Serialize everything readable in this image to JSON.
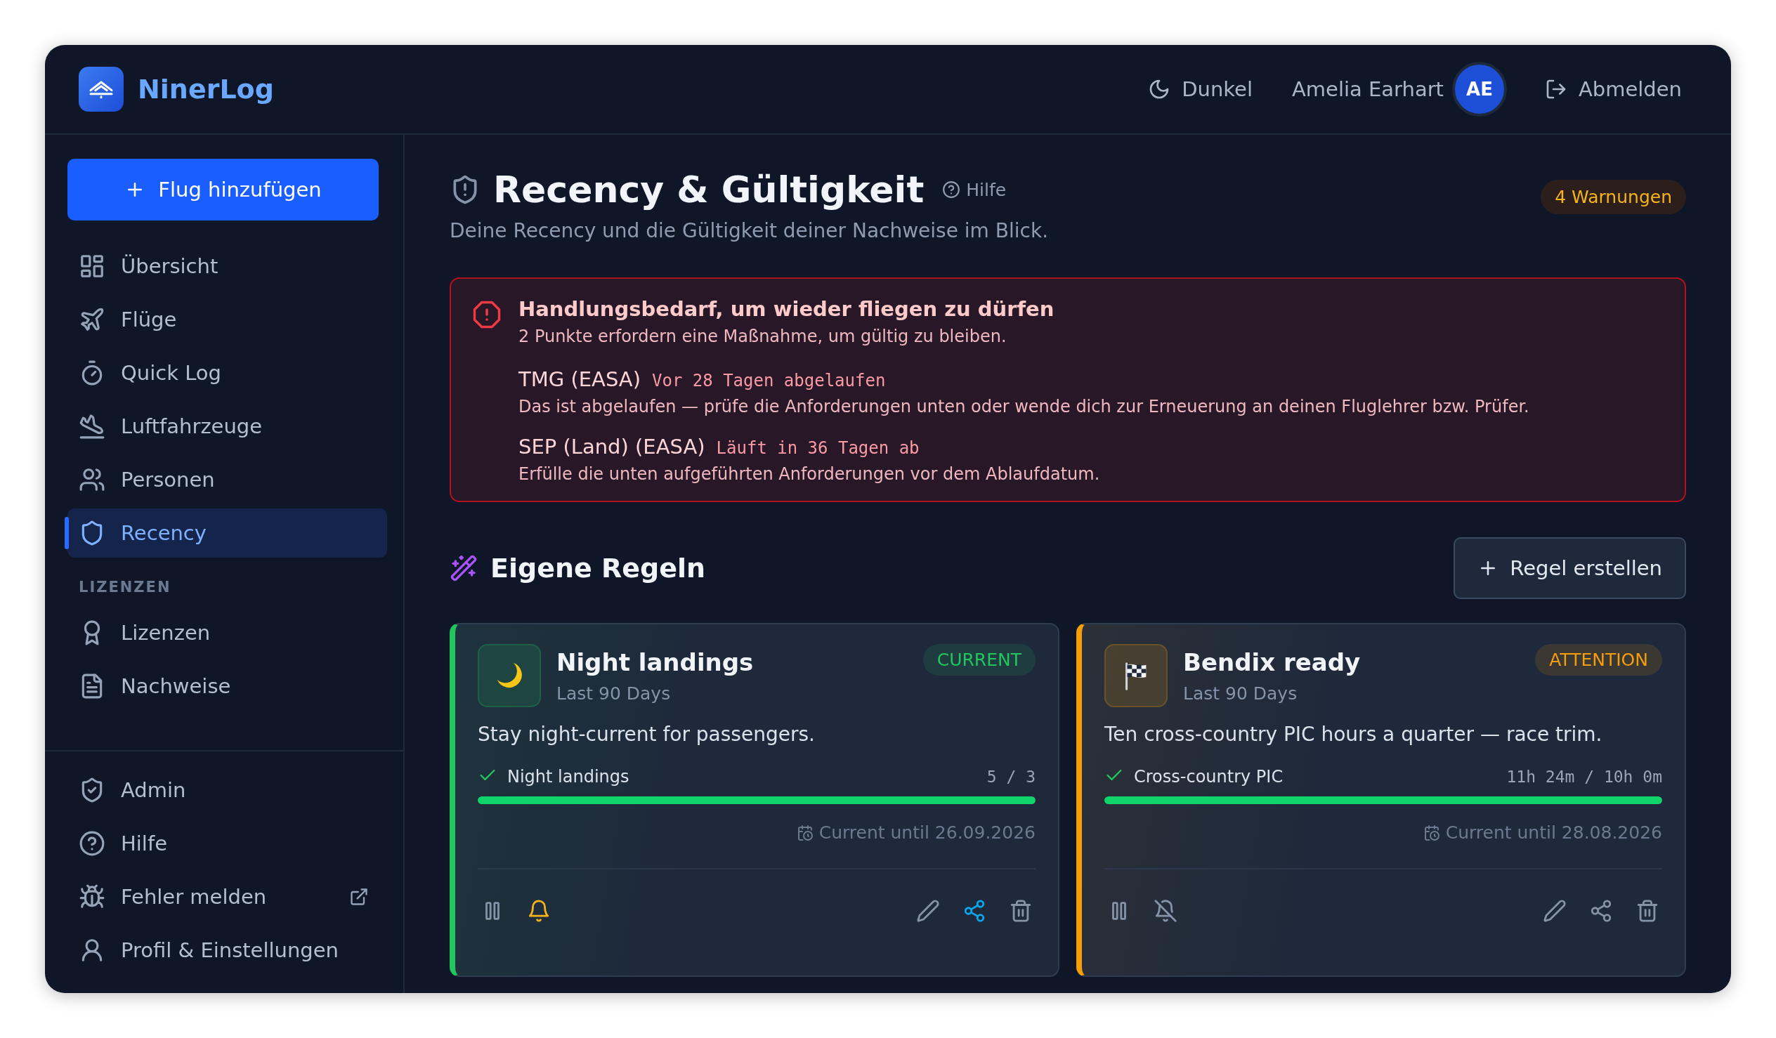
{
  "header": {
    "brand": "NinerLog",
    "theme_toggle": "Dunkel",
    "user_name": "Amelia Earhart",
    "avatar_initials": "AE",
    "logout": "Abmelden"
  },
  "sidebar": {
    "add_button": "Flug hinzufügen",
    "items": [
      {
        "label": "Übersicht",
        "selected": false
      },
      {
        "label": "Flüge",
        "selected": false
      },
      {
        "label": "Quick Log",
        "selected": false
      },
      {
        "label": "Luftfahrzeuge",
        "selected": false
      },
      {
        "label": "Personen",
        "selected": false
      },
      {
        "label": "Recency",
        "selected": true
      }
    ],
    "section_title": "LIZENZEN",
    "section_items": [
      {
        "label": "Lizenzen",
        "selected": false
      },
      {
        "label": "Nachweise",
        "selected": false
      }
    ],
    "bottom_items": [
      {
        "label": "Admin",
        "external": false
      },
      {
        "label": "Hilfe",
        "external": false
      },
      {
        "label": "Fehler melden",
        "external": true
      },
      {
        "label": "Profil & Einstellungen",
        "external": false
      }
    ]
  },
  "page": {
    "title": "Recency & Gültigkeit",
    "help": "Hilfe",
    "subtitle": "Deine Recency und die Gültigkeit deiner Nachweise im Blick.",
    "badge": "4 Warnungen"
  },
  "alert": {
    "title": "Handlungsbedarf, um wieder fliegen zu dürfen",
    "summary": "2 Punkte erfordern eine Maßnahme, um gültig zu bleiben.",
    "items": [
      {
        "name": "TMG (EASA)",
        "status": "Vor 28 Tagen abgelaufen",
        "text": "Das ist abgelaufen — prüfe die Anforderungen unten oder wende dich zur Erneuerung an deinen Fluglehrer bzw. Prüfer."
      },
      {
        "name": "SEP (Land) (EASA)",
        "status": "Läuft in 36 Tagen ab",
        "text": "Erfülle die unten aufgeführten Anforderungen vor dem Ablaufdatum."
      }
    ]
  },
  "rules": {
    "title": "Eigene Regeln",
    "create_button": "Regel erstellen",
    "cards": [
      {
        "title": "Night landings",
        "period": "Last 90 Days",
        "status": "CURRENT",
        "color": "#22c55e",
        "description": "Stay night-current for passengers.",
        "requirement": {
          "label": "Night landings",
          "reading": "5 / 3",
          "level": 1,
          "met": true
        },
        "valid_until": "Current until 26.09.2026",
        "notifications": true,
        "shared": true
      },
      {
        "title": "Bendix ready",
        "period": "Last 90 Days",
        "status": "ATTENTION",
        "color": "#f59e0b",
        "description": "Ten cross-country PIC hours a quarter — race trim.",
        "requirement": {
          "label": "Cross-country PIC",
          "reading": "11h 24m / 10h 0m",
          "level": 1,
          "met": true
        },
        "valid_until": "Current until 28.08.2026",
        "notifications": false,
        "shared": false
      }
    ]
  }
}
